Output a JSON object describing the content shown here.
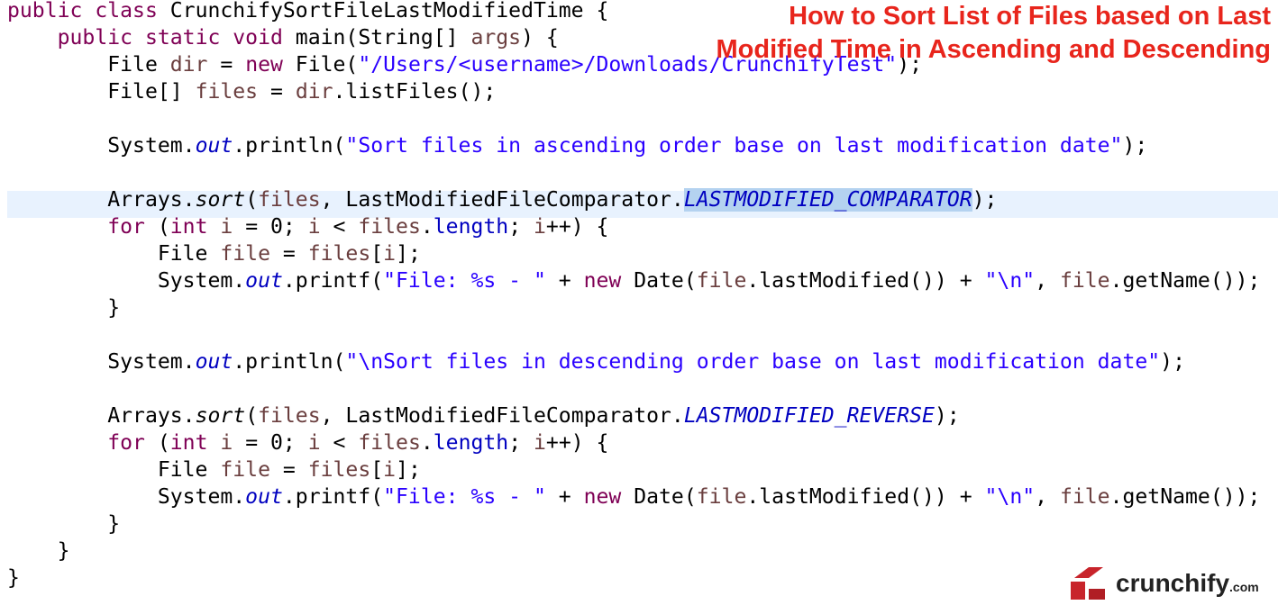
{
  "code_lines": [
    [
      {
        "t": "public",
        "c": "kw"
      },
      {
        "t": " "
      },
      {
        "t": "class",
        "c": "kw"
      },
      {
        "t": " CrunchifySortFileLastModifiedTime {"
      }
    ],
    [
      {
        "t": "    "
      },
      {
        "t": "public",
        "c": "kw"
      },
      {
        "t": " "
      },
      {
        "t": "static",
        "c": "kw"
      },
      {
        "t": " "
      },
      {
        "t": "void",
        "c": "kw"
      },
      {
        "t": " main(String[] "
      },
      {
        "t": "args",
        "c": "loc"
      },
      {
        "t": ") {"
      }
    ],
    [
      {
        "t": "        File "
      },
      {
        "t": "dir",
        "c": "loc"
      },
      {
        "t": " = "
      },
      {
        "t": "new",
        "c": "kw"
      },
      {
        "t": " File("
      },
      {
        "t": "\"/Users/<username>/Downloads/CrunchifyTest\"",
        "c": "str"
      },
      {
        "t": ");"
      }
    ],
    [
      {
        "t": "        File[] "
      },
      {
        "t": "files",
        "c": "loc"
      },
      {
        "t": " = "
      },
      {
        "t": "dir",
        "c": "loc"
      },
      {
        "t": ".listFiles();"
      }
    ],
    [],
    [
      {
        "t": "        System."
      },
      {
        "t": "out",
        "c": "fld it"
      },
      {
        "t": ".println("
      },
      {
        "t": "\"Sort files in ascending order base on last modification date\"",
        "c": "str"
      },
      {
        "t": ");"
      }
    ],
    [],
    [
      {
        "t": "        Arrays."
      },
      {
        "t": "sort",
        "c": "it"
      },
      {
        "t": "("
      },
      {
        "t": "files",
        "c": "loc"
      },
      {
        "t": ", LastModifiedFileComparator."
      },
      {
        "t": "LASTMODIFIED_COMPARATOR",
        "c": "cst sel"
      },
      {
        "t": ");"
      }
    ],
    [
      {
        "t": "        "
      },
      {
        "t": "for",
        "c": "kw"
      },
      {
        "t": " ("
      },
      {
        "t": "int",
        "c": "kw"
      },
      {
        "t": " "
      },
      {
        "t": "i",
        "c": "loc"
      },
      {
        "t": " = 0; "
      },
      {
        "t": "i",
        "c": "loc"
      },
      {
        "t": " < "
      },
      {
        "t": "files",
        "c": "loc"
      },
      {
        "t": "."
      },
      {
        "t": "length",
        "c": "fld"
      },
      {
        "t": "; "
      },
      {
        "t": "i",
        "c": "loc"
      },
      {
        "t": "++) {"
      }
    ],
    [
      {
        "t": "            File "
      },
      {
        "t": "file",
        "c": "loc"
      },
      {
        "t": " = "
      },
      {
        "t": "files",
        "c": "loc"
      },
      {
        "t": "["
      },
      {
        "t": "i",
        "c": "loc"
      },
      {
        "t": "];"
      }
    ],
    [
      {
        "t": "            System."
      },
      {
        "t": "out",
        "c": "fld it"
      },
      {
        "t": ".printf("
      },
      {
        "t": "\"File: %s - \"",
        "c": "str"
      },
      {
        "t": " + "
      },
      {
        "t": "new",
        "c": "kw"
      },
      {
        "t": " Date("
      },
      {
        "t": "file",
        "c": "loc"
      },
      {
        "t": ".lastModified()) + "
      },
      {
        "t": "\"\\n\"",
        "c": "str"
      },
      {
        "t": ", "
      },
      {
        "t": "file",
        "c": "loc"
      },
      {
        "t": ".getName());"
      }
    ],
    [
      {
        "t": "        }"
      }
    ],
    [],
    [
      {
        "t": "        System."
      },
      {
        "t": "out",
        "c": "fld it"
      },
      {
        "t": ".println("
      },
      {
        "t": "\"\\nSort files in descending order base on last modification date\"",
        "c": "str"
      },
      {
        "t": ");"
      }
    ],
    [],
    [
      {
        "t": "        Arrays."
      },
      {
        "t": "sort",
        "c": "it"
      },
      {
        "t": "("
      },
      {
        "t": "files",
        "c": "loc"
      },
      {
        "t": ", LastModifiedFileComparator."
      },
      {
        "t": "LASTMODIFIED_REVERSE",
        "c": "cst"
      },
      {
        "t": ");"
      }
    ],
    [
      {
        "t": "        "
      },
      {
        "t": "for",
        "c": "kw"
      },
      {
        "t": " ("
      },
      {
        "t": "int",
        "c": "kw"
      },
      {
        "t": " "
      },
      {
        "t": "i",
        "c": "loc"
      },
      {
        "t": " = 0; "
      },
      {
        "t": "i",
        "c": "loc"
      },
      {
        "t": " < "
      },
      {
        "t": "files",
        "c": "loc"
      },
      {
        "t": "."
      },
      {
        "t": "length",
        "c": "fld"
      },
      {
        "t": "; "
      },
      {
        "t": "i",
        "c": "loc"
      },
      {
        "t": "++) {"
      }
    ],
    [
      {
        "t": "            File "
      },
      {
        "t": "file",
        "c": "loc"
      },
      {
        "t": " = "
      },
      {
        "t": "files",
        "c": "loc"
      },
      {
        "t": "["
      },
      {
        "t": "i",
        "c": "loc"
      },
      {
        "t": "];"
      }
    ],
    [
      {
        "t": "            System."
      },
      {
        "t": "out",
        "c": "fld it"
      },
      {
        "t": ".printf("
      },
      {
        "t": "\"File: %s - \"",
        "c": "str"
      },
      {
        "t": " + "
      },
      {
        "t": "new",
        "c": "kw"
      },
      {
        "t": " Date("
      },
      {
        "t": "file",
        "c": "loc"
      },
      {
        "t": ".lastModified()) + "
      },
      {
        "t": "\"\\n\"",
        "c": "str"
      },
      {
        "t": ", "
      },
      {
        "t": "file",
        "c": "loc"
      },
      {
        "t": ".getName());"
      }
    ],
    [
      {
        "t": "        }"
      }
    ],
    [
      {
        "t": "    }"
      }
    ],
    [
      {
        "t": "}"
      }
    ]
  ],
  "headline": {
    "line1": "How to Sort List of Files based on Last",
    "line2": "Modified Time in Ascending and Descending"
  },
  "brand": {
    "name": "crunchify",
    "suffix": ".com"
  },
  "colors": {
    "keyword": "#7f0055",
    "string": "#2a00ff",
    "field": "#0000c0",
    "local_variable": "#6a3e3e",
    "current_line": "#e8f2fe",
    "selection": "#b4d2f0",
    "headline": "#e8251c",
    "brand_mark": "#c8242b"
  }
}
